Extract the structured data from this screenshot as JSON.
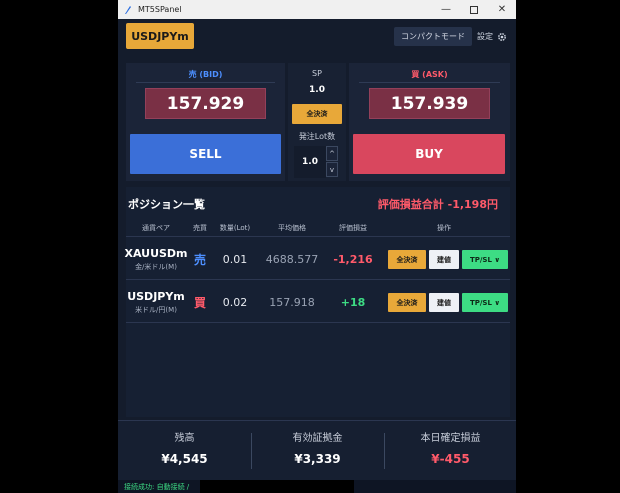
{
  "window": {
    "title": "MT5SPanel"
  },
  "header": {
    "symbol_button": "USDJPYm",
    "compact_button": "コンパクトモード",
    "settings_label": "設定"
  },
  "quote": {
    "bid_label": "売 (BID)",
    "bid_price": "157.929",
    "sell_button": "SELL",
    "ask_label": "買 (ASK)",
    "ask_price": "157.939",
    "buy_button": "BUY",
    "sp_label": "SP",
    "sp_value": "1.0",
    "close_all_button": "全決済",
    "lot_label": "発注Lot数",
    "lot_value": "1.0",
    "lot_up": "^",
    "lot_down": "v"
  },
  "positions": {
    "title": "ポジション一覧",
    "pnl_total": "評価損益合計 -1,198円",
    "columns": [
      "通貨ペア",
      "売買",
      "数量(Lot)",
      "平均価格",
      "評価損益",
      "操作"
    ],
    "rows": [
      {
        "symbol": "XAUUSDm",
        "symbol_sub": "金/米ドル(M)",
        "side": "売",
        "qty": "0.01",
        "avg_price": "4688.577",
        "pnl": "-1,216",
        "close_btn": "全決済",
        "modify_btn": "建値",
        "tpsl_btn": "TP/SL ∨"
      },
      {
        "symbol": "USDJPYm",
        "symbol_sub": "米ドル/円(M)",
        "side": "買",
        "qty": "0.02",
        "avg_price": "157.918",
        "pnl": "+18",
        "close_btn": "全決済",
        "modify_btn": "建値",
        "tpsl_btn": "TP/SL ∨"
      }
    ]
  },
  "footer": {
    "balance_label": "残高",
    "balance_value": "¥4,545",
    "margin_label": "有効証拠金",
    "margin_value": "¥3,339",
    "realized_label": "本日確定損益",
    "realized_value": "¥-455"
  },
  "status": {
    "text": "接続成功: 自動接続 /"
  },
  "colors": {
    "accent": "#e8a839",
    "sell": "#3b6fd8",
    "buy": "#d9475e",
    "price_box": "#7a3045",
    "profit": "#3ddc84",
    "loss": "#ff5a6a",
    "bid_label": "#4d8fff",
    "ask_label": "#ff5a6a",
    "tpsl": "#3ddc84"
  }
}
